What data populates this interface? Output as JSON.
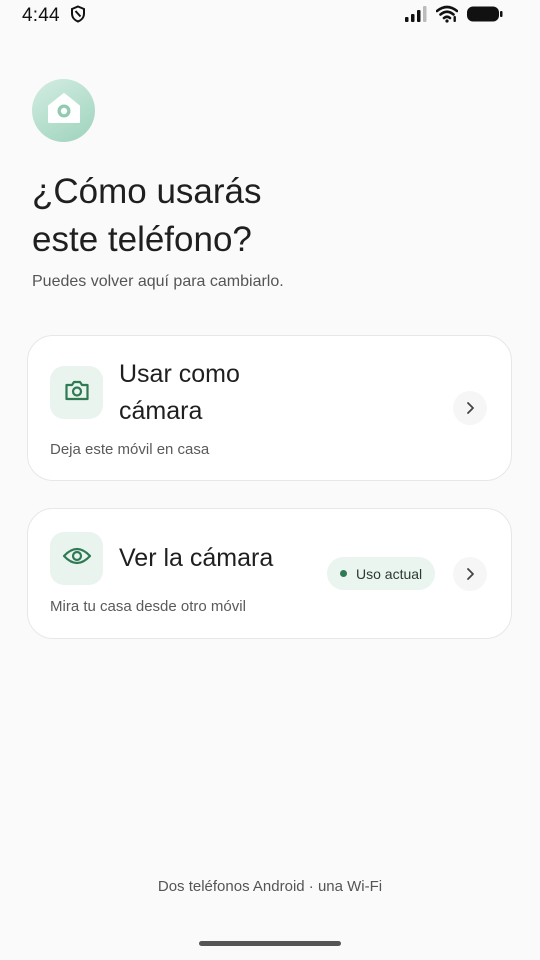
{
  "status_bar": {
    "time": "4:44",
    "icons": [
      "shield-icon",
      "signal-icon",
      "wifi-icon",
      "battery-icon"
    ]
  },
  "header": {
    "logo_icon": "home-camera-icon",
    "title_lines": [
      "¿Cómo usarás",
      "este teléfono?"
    ],
    "subtitle": "Puedes volver aquí para cambiarlo."
  },
  "options": [
    {
      "icon": "camera-icon",
      "title_lines": [
        "Usar como",
        "cámara"
      ],
      "description": "Deja este móvil en casa"
    },
    {
      "icon": "eye-icon",
      "title": "Ver la cámara",
      "badge": "Uso actual",
      "description": "Mira tu casa desde otro móvil"
    }
  ],
  "footer": {
    "note": "Dos teléfonos Android · una Wi-Fi"
  },
  "colors": {
    "accent": "#2f7a55",
    "accent_light": "#e9f4ee",
    "logo_gradient_start": "#d3ede2",
    "logo_gradient_end": "#9ed3bd"
  }
}
